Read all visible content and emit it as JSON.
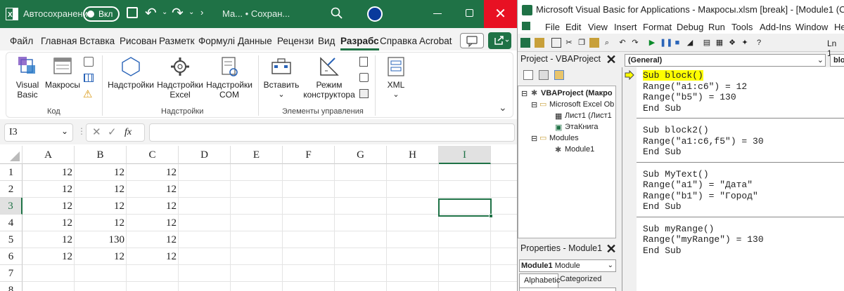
{
  "excel": {
    "title": {
      "autosave": "Автосохранение",
      "toggle": "Вкл",
      "file": "Ма... • Сохран...",
      "close": "✕"
    },
    "tabs": [
      "Файл",
      "Главная",
      "Вставка",
      "Рисован",
      "Разметк",
      "Формулі",
      "Данные",
      "Рецензи",
      "Вид",
      "Разрабс",
      "Справка",
      "Acrobat"
    ],
    "active_tab": "Разрабс",
    "ribbon": {
      "visual_basic": [
        "Visual",
        "Basic"
      ],
      "macros": "Макросы",
      "group_code": "Код",
      "addins": "Надстройки",
      "excel_addins": [
        "Надстройки",
        "Excel"
      ],
      "com_addins": [
        "Надстройки",
        "COM"
      ],
      "group_addins": "Надстройки",
      "insert": "Вставить",
      "design_mode": [
        "Режим",
        "конструктора"
      ],
      "group_controls": "Элементы управления",
      "xml": "XML"
    },
    "name_box": "I3",
    "fx": "fx",
    "columns": [
      "A",
      "B",
      "C",
      "D",
      "E",
      "F",
      "G",
      "H",
      "I"
    ],
    "active_column": "I",
    "rows": [
      {
        "n": "1",
        "a": "12",
        "b": "12",
        "c": "12"
      },
      {
        "n": "2",
        "a": "12",
        "b": "12",
        "c": "12"
      },
      {
        "n": "3",
        "a": "12",
        "b": "12",
        "c": "12"
      },
      {
        "n": "4",
        "a": "12",
        "b": "12",
        "c": "12"
      },
      {
        "n": "5",
        "a": "12",
        "b": "130",
        "c": "12"
      },
      {
        "n": "6",
        "a": "12",
        "b": "12",
        "c": "12"
      },
      {
        "n": "7",
        "a": "",
        "b": "",
        "c": ""
      },
      {
        "n": "8",
        "a": "",
        "b": "",
        "c": ""
      }
    ]
  },
  "vbe": {
    "title": "Microsoft Visual Basic for Applications - Макросы.xlsm [break] - [Module1 (Code)]",
    "menu": [
      "File",
      "Edit",
      "View",
      "Insert",
      "Format",
      "Debug",
      "Run",
      "Tools",
      "Add-Ins",
      "Window",
      "He"
    ],
    "menu_keys": [
      "F",
      "E",
      "V",
      "I",
      "o",
      "D",
      "R",
      "T",
      "A",
      "W",
      "H"
    ],
    "pos": "Ln 1,",
    "project_title": "Project - VBAProject",
    "tree": {
      "root": "VBAProject (Макро",
      "objects": "Microsoft Excel Ob",
      "sheet": "Лист1 (Лист1",
      "book": "ЭтаКнига",
      "modules": "Modules",
      "module": "Module1"
    },
    "props_title": "Properties - Module1",
    "props_object": "Module1",
    "props_type": "Module",
    "props_tabs": [
      "Alphabetic",
      "Categorized"
    ],
    "combo_left": "(General)",
    "combo_right": "blo",
    "code": [
      [
        "Sub block()",
        "Range(\"a1:c6\") = 12",
        "Range(\"b5\") = 130",
        "End Sub"
      ],
      [
        "Sub block2()",
        "Range(\"a1:c6,f5\") = 30",
        "End Sub"
      ],
      [
        "Sub MyText()",
        "Range(\"a1\") = \"Дата\"",
        "Range(\"b1\") = \"Город\"",
        "End Sub"
      ],
      [
        "Sub myRange()",
        "Range(\"myRange\") = 130",
        "End Sub"
      ]
    ]
  }
}
